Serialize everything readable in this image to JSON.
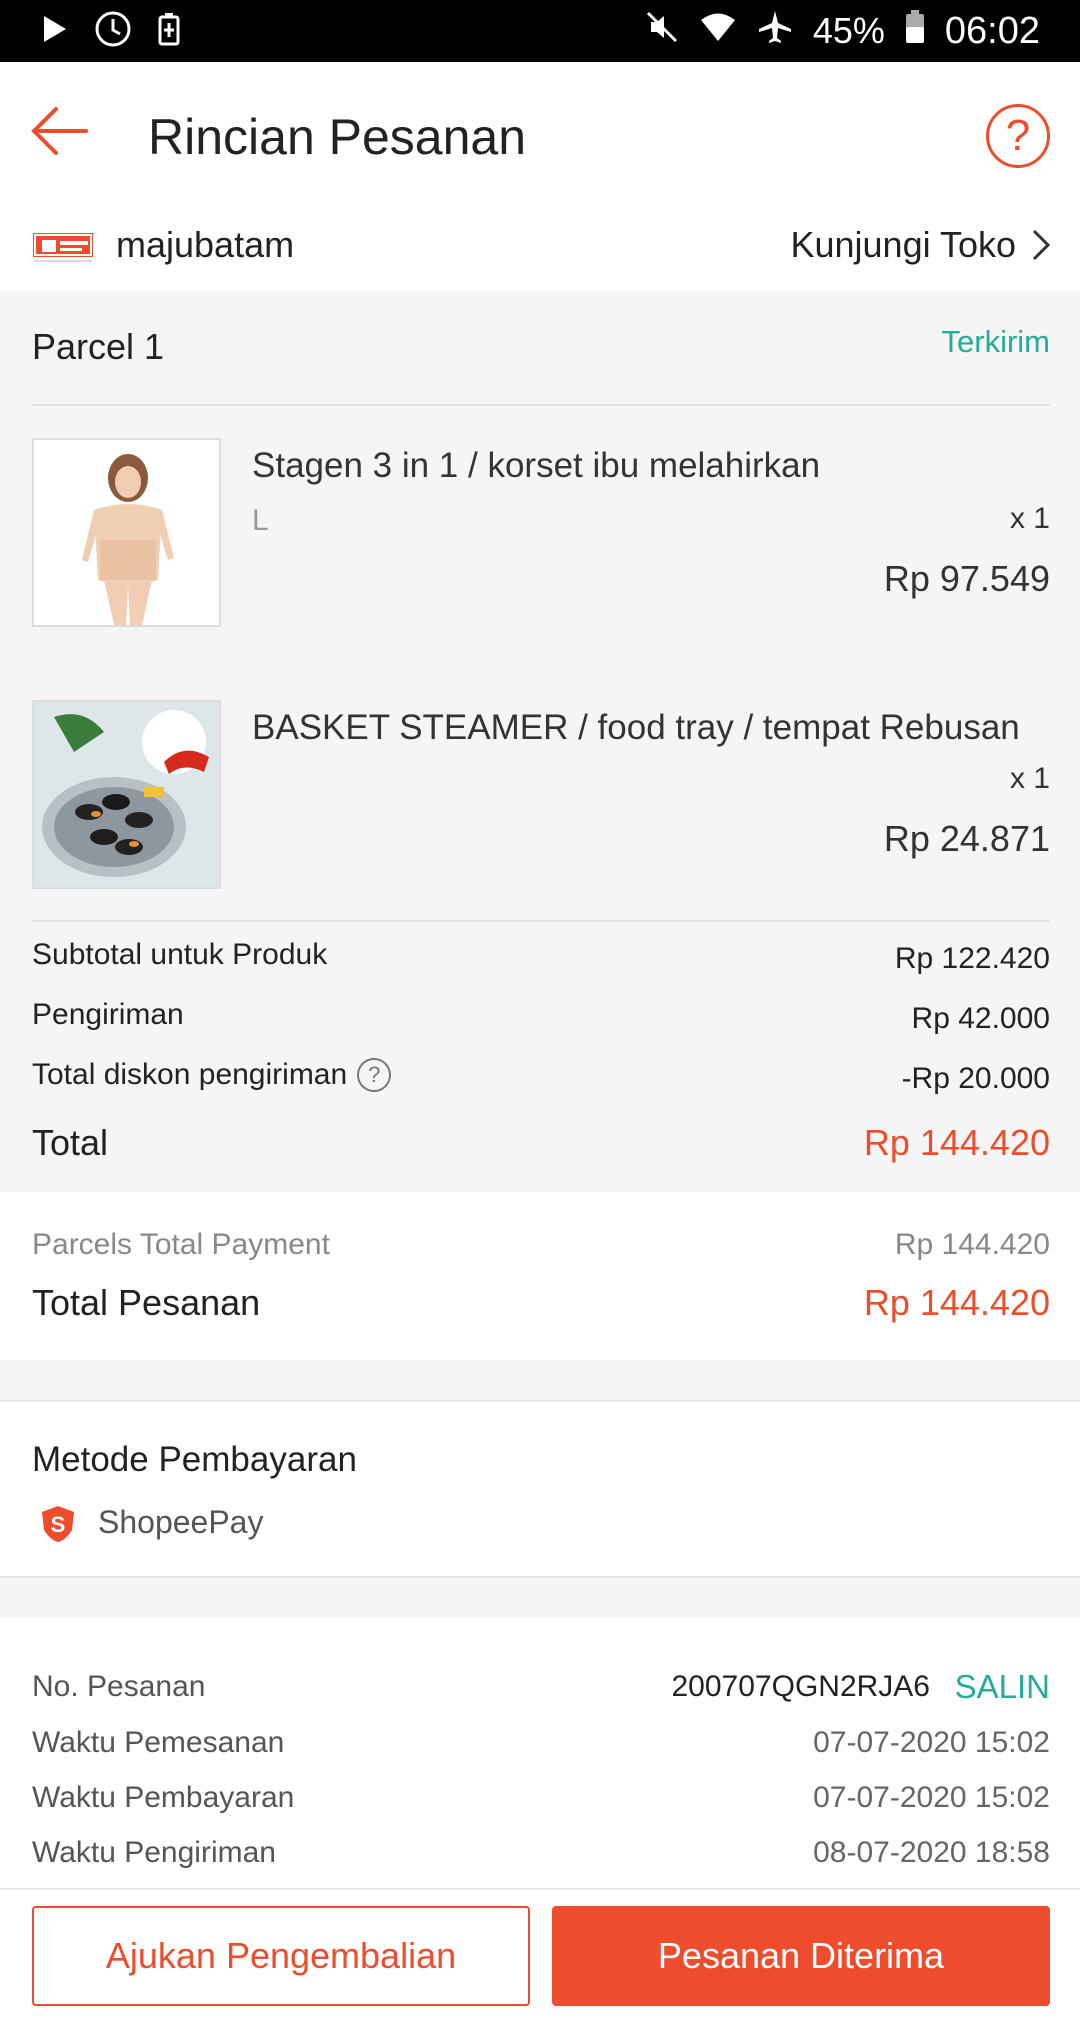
{
  "status_bar": {
    "battery": "45%",
    "time": "06:02",
    "icons": [
      "play-icon",
      "clock-icon",
      "battery-saver-icon",
      "mute-icon",
      "wifi-icon",
      "airplane-icon",
      "battery-icon"
    ]
  },
  "header": {
    "title": "Rincian Pesanan",
    "back_icon": "arrow-left-icon",
    "help_label": "?"
  },
  "shop": {
    "name": "majubatam",
    "visit_label": "Kunjungi Toko"
  },
  "parcel": {
    "title": "Parcel 1",
    "status": "Terkirim",
    "products": [
      {
        "name": "Stagen 3 in 1 / korset ibu melahirkan",
        "variant": "L",
        "qty": "x 1",
        "price": "Rp 97.549"
      },
      {
        "name": "BASKET STEAMER / food tray / tempat Rebusan",
        "variant": "",
        "qty": "x 1",
        "price": "Rp 24.871"
      }
    ],
    "summary": {
      "subtotal_label": "Subtotal untuk Produk",
      "subtotal_value": "Rp 122.420",
      "shipping_label": "Pengiriman",
      "shipping_value": "Rp 42.000",
      "discount_label": "Total diskon pengiriman",
      "discount_value": "-Rp 20.000",
      "total_label": "Total",
      "total_value": "Rp 144.420"
    }
  },
  "payment_totals": {
    "parcels_label": "Parcels Total Payment",
    "parcels_value": "Rp 144.420",
    "order_total_label": "Total Pesanan",
    "order_total_value": "Rp 144.420"
  },
  "payment_method": {
    "title": "Metode Pembayaran",
    "method": "ShopeePay"
  },
  "order_info": {
    "order_no_label": "No. Pesanan",
    "order_no": "200707QGN2RJA6",
    "copy_label": "SALIN",
    "order_time_label": "Waktu Pemesanan",
    "order_time": "07-07-2020 15:02",
    "payment_time_label": "Waktu Pembayaran",
    "payment_time": "07-07-2020 15:02",
    "ship_time_label": "Waktu Pengiriman",
    "ship_time": "08-07-2020 18:58"
  },
  "actions": {
    "return_label": "Ajukan Pengembalian",
    "received_label": "Pesanan Diterima"
  },
  "colors": {
    "accent": "#ee4d2d",
    "success": "#26aa99"
  }
}
